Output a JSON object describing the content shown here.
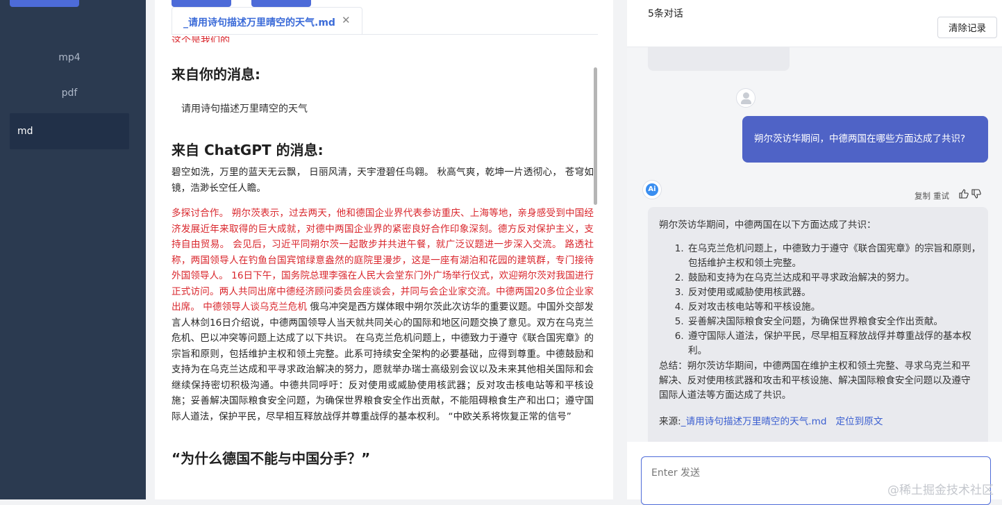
{
  "sidebar": {
    "items": [
      {
        "label": "mp4"
      },
      {
        "label": "pdf"
      },
      {
        "label": "md"
      }
    ]
  },
  "document": {
    "tab_title": "_请用诗句描述万里晴空的天气.md",
    "close_glyph": "✕",
    "cut_line": "这个是我们的",
    "heading_you": "来自你的消息:",
    "user_message": "请用诗句描述万里晴空的天气",
    "heading_gpt": "来自 ChatGPT 的消息:",
    "poem": "碧空如洗，万里的蓝天无云飘， 日丽风清，天宇澄碧任鸟翱。 秋高气爽，乾坤一片透彻心， 苍穹如镜，浩渺长空任人瞻。",
    "red_text": "多探讨合作。 朔尔茨表示，过去两天，他和德国企业界代表参访重庆、上海等地，亲身感受到中国经济发展近年来取得的巨大成就，对德中两国企业界的紧密良好合作印象深刻。德方反对保护主义，支持自由贸易。 会见后，习近平同朔尔茨一起散步并共进午餐，就广泛议题进一步深入交流。 路透社称，两国领导人在钓鱼台国宾馆绿意盎然的庭院里漫步，这是一座有湖泊和花园的建筑群，专门接待外国领导人。 16日下午，国务院总理李强在人民大会堂东门外广场举行仪式，欢迎朔尔茨对我国进行正式访问。两人共同出席中德经济顾问委员会座谈会，并同与会企业家交流。中德两国20多位企业家出席。 中德领导人谈乌克兰危机",
    "black_text": " 俄乌冲突是西方媒体眼中朔尔茨此次访华的重要议题。中国外交部发言人林剑16日介绍说，中德两国领导人当天就共同关心的国际和地区问题交换了意见。双方在乌克兰危机、巴以冲突等问题上达成了以下共识。 在乌克兰危机问题上，中德致力于遵守《联合国宪章》的宗旨和原则，包括维护主权和领土完整。此系可持续安全架构的必要基础，应得到尊重。中德鼓励和支持为在乌克兰达成和平寻求政治解决的努力，愿就举办瑞士高级别会议以及未来其他相关国际和会继续保持密切积极沟通。中德共同呼吁：反对使用或威胁使用核武器；反对攻击核电站等和平核设施；妥善解决国际粮食安全问题，为确保世界粮食安全作出贡献，不能阻碍粮食生产和出口；遵守国际人道法，保护平民，尽早相互释放战俘并尊重战俘的基本权利。 “中欧关系将恢复正常的信号”",
    "heading_why": "“为什么德国不能与中国分手？”"
  },
  "chat": {
    "count_label": "5条对话",
    "clear_button": "清除记录",
    "user_question": "朔尔茨访华期间，中德两国在哪些方面达成了共识?",
    "ai_badge": "Ai",
    "actions": {
      "copy": "复制",
      "retry": "重试"
    },
    "answer_intro": "朔尔茨访华期间，中德两国在以下方面达成了共识：",
    "answer_points": [
      "在乌克兰危机问题上，中德致力于遵守《联合国宪章》的宗旨和原则，包括维护主权和领土完整。",
      "鼓励和支持为在乌克兰达成和平寻求政治解决的努力。",
      "反对使用或威胁使用核武器。",
      "反对攻击核电站等和平核设施。",
      "妥善解决国际粮食安全问题，为确保世界粮食安全作出贡献。",
      "遵守国际人道法，保护平民，尽早相互释放战俘并尊重战俘的基本权利。"
    ],
    "answer_summary": "总结：朔尔茨访华期间，中德两国在维护主权和领土完整、寻求乌克兰和平解决、反对使用核武器和攻击和平核设施、解决国际粮食安全问题以及遵守国际人道法等方面达成了共识。",
    "source_label": "来源:",
    "source_link": "_请用诗句描述万里晴空的天气.md",
    "locate_link": "定位到原文",
    "input_placeholder": "Enter 发送"
  },
  "watermark": "@稀土掘金技术社区",
  "colors": {
    "sidebar_bg": "#2b3a50",
    "accent": "#4d6bd8",
    "user_bubble": "#4f63c6",
    "highlight_red": "#d9262c",
    "link_blue": "#3b5fd0"
  }
}
